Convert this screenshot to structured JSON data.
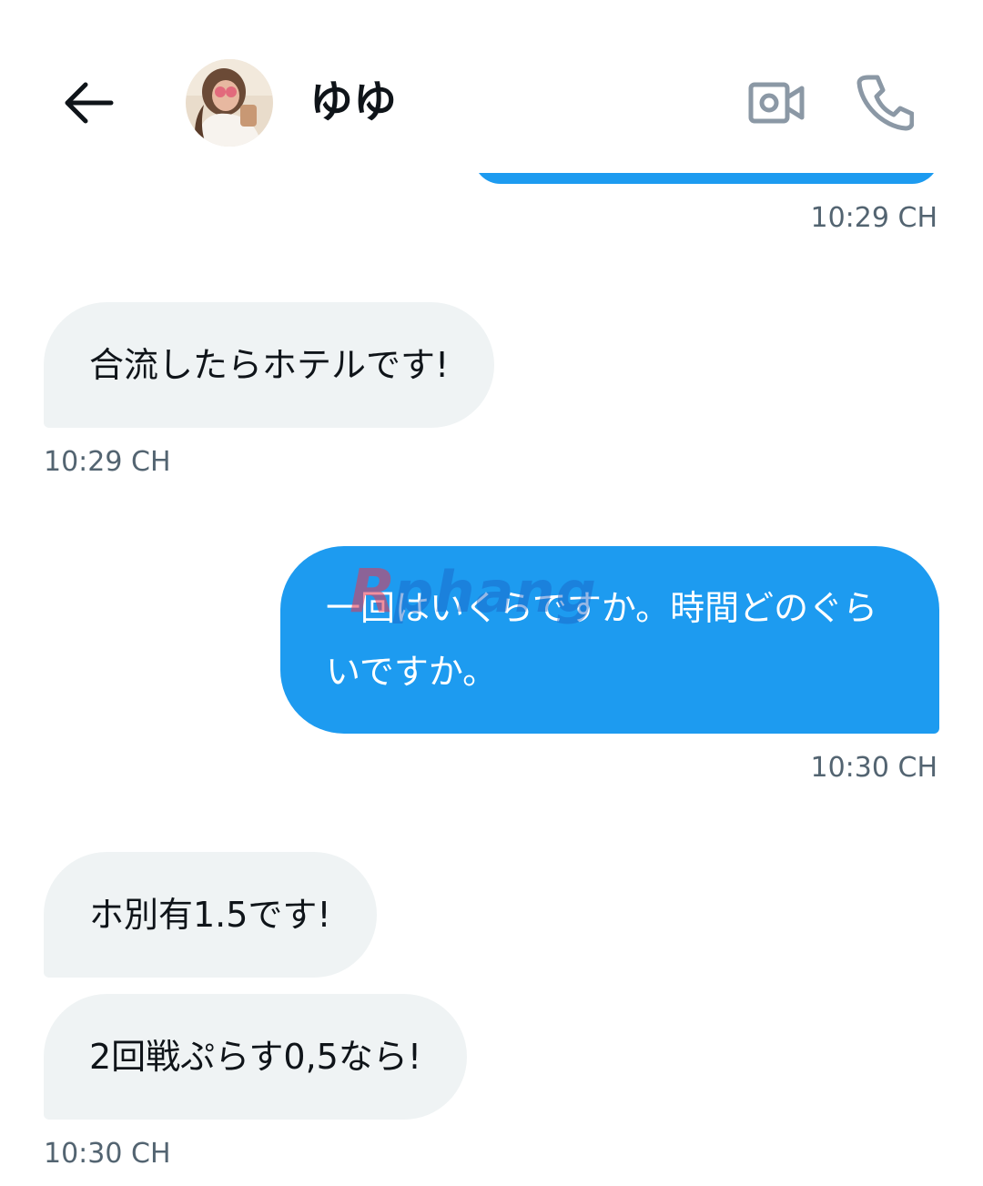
{
  "header": {
    "contact_name": "ゆゆ",
    "back_icon": "arrow-left-icon",
    "video_icon": "video-camera-icon",
    "call_icon": "phone-icon"
  },
  "messages": [
    {
      "direction": "out",
      "text": "",
      "time": "10:29 CH"
    },
    {
      "direction": "in",
      "text": "合流したらホテルです!",
      "time": "10:29 CH"
    },
    {
      "direction": "out",
      "text": "一回はいくらですか。時間どのぐらいですか。",
      "time": "10:30 CH"
    },
    {
      "direction": "in",
      "text": "ホ別有1.5です!",
      "time": ""
    },
    {
      "direction": "in",
      "text": "2回戦ぷらす0,5なら!",
      "time": "10:30 CH"
    }
  ],
  "watermark": {
    "text": "Rphang"
  },
  "colors": {
    "outgoing_bubble": "#1d9bf0",
    "incoming_bubble": "#eff3f4",
    "timestamp": "#536471",
    "icon_gray": "#8b98a5"
  }
}
